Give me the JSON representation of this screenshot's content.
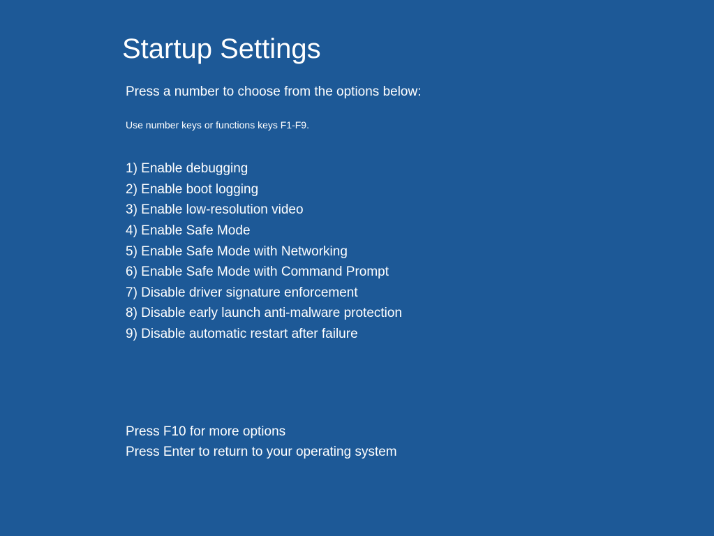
{
  "title": "Startup Settings",
  "instruction": "Press a number to choose from the options below:",
  "hint": "Use number keys or functions keys F1-F9.",
  "options": [
    "1) Enable debugging",
    "2) Enable boot logging",
    "3) Enable low-resolution video",
    "4) Enable Safe Mode",
    "5) Enable Safe Mode with Networking",
    "6) Enable Safe Mode with Command Prompt",
    "7) Disable driver signature enforcement",
    "8) Disable early launch anti-malware protection",
    "9) Disable automatic restart after failure"
  ],
  "footer": {
    "more_options": "Press F10 for more options",
    "return": "Press Enter to return to your operating system"
  }
}
